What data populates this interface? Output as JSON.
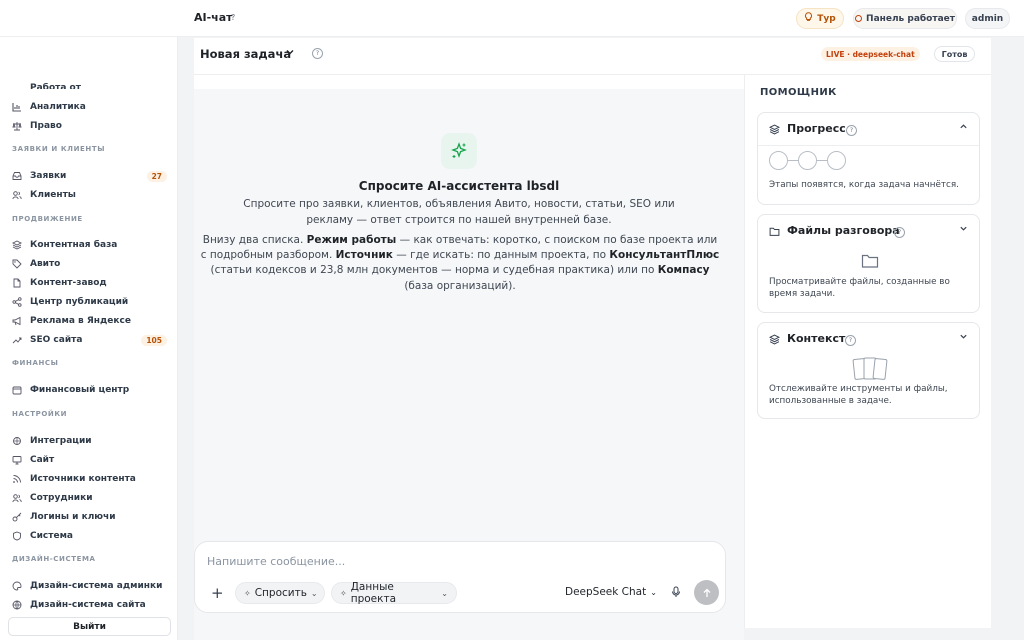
{
  "header": {
    "app_title": "AI-чат",
    "help": "?",
    "tour_label": "Тур",
    "panel_label": "Панель работает",
    "admin_label": "admin"
  },
  "sidebar": {
    "cut_item": "Работа от отзыв",
    "items_top": [
      {
        "icon": "chart-icon",
        "label": "Аналитика"
      },
      {
        "icon": "scale-icon",
        "label": "Право"
      }
    ],
    "sections": {
      "requests": "ЗАЯВКИ И КЛИЕНТЫ",
      "promotion": "ПРОДВИЖЕНИЕ",
      "finance": "ФИНАНСЫ",
      "settings": "НАСТРОЙКИ",
      "design": "ДИЗАЙН-СИСТЕМА"
    },
    "requests_items": [
      {
        "icon": "inbox-icon",
        "label": "Заявки",
        "badge": "27"
      },
      {
        "icon": "users-icon",
        "label": "Клиенты"
      }
    ],
    "promotion_items": [
      {
        "icon": "layers-icon",
        "label": "Контентная база"
      },
      {
        "icon": "tag-icon",
        "label": "Авито"
      },
      {
        "icon": "file-icon",
        "label": "Контент-завод"
      },
      {
        "icon": "share-icon",
        "label": "Центр публикаций"
      },
      {
        "icon": "megaphone-icon",
        "label": "Реклама в Яндексе"
      },
      {
        "icon": "trend-icon",
        "label": "SEO сайта",
        "badge": "105"
      }
    ],
    "finance_items": [
      {
        "icon": "wallet-icon",
        "label": "Финансовый центр"
      }
    ],
    "settings_items": [
      {
        "icon": "plug-icon",
        "label": "Интеграции"
      },
      {
        "icon": "monitor-icon",
        "label": "Сайт"
      },
      {
        "icon": "rss-icon",
        "label": "Источники контента"
      },
      {
        "icon": "team-icon",
        "label": "Сотрудники"
      },
      {
        "icon": "key-icon",
        "label": "Логины и ключи"
      },
      {
        "icon": "shield-icon",
        "label": "Система"
      }
    ],
    "design_items": [
      {
        "icon": "palette-icon",
        "label": "Дизайн-система админки"
      },
      {
        "icon": "globe-icon",
        "label": "Дизайн-система сайта"
      }
    ],
    "logout_label": "Выйти"
  },
  "task": {
    "title": "Новая задача",
    "live_badge": "LIVE · deepseek-chat",
    "status": "Готов"
  },
  "chat": {
    "empty_title": "Спросите AI-ассистента lbsdl",
    "empty_desc": "Спросите про заявки, клиентов, объявления Авито, новости, статьи, SEO или рекламу — ответ строится по нашей внутренней базе.",
    "hint_1": "Внизу два списка. ",
    "hint_mode": "Режим работы",
    "hint_2": " — как отвечать: коротко, с поиском по базе проекта или с подробным разбором. ",
    "hint_source": "Источник",
    "hint_3": " — где искать: по данным проекта, по ",
    "hint_kp": "КонсультантПлюс",
    "hint_4": " (статьи кодексов и 23,8 млн документов — норма и судебная практика) или по ",
    "hint_compass": "Компасу",
    "hint_5": " (база организаций).",
    "input_placeholder": "Напишите сообщение...",
    "ask_label": "Спросить",
    "data_label": "Данные проекта",
    "model_label": "DeepSeek Chat"
  },
  "panel": {
    "title": "ПОМОЩНИК",
    "progress_title": "Прогресс",
    "progress_text": "Этапы появятся, когда задача начнётся.",
    "files_title": "Файлы разговора",
    "files_text": "Просматривайте файлы, созданные во время задачи.",
    "context_title": "Контекст",
    "context_text": "Отслеживайте инструменты и файлы, использованные в задаче."
  },
  "colors": {
    "accent": "#c2410c",
    "success": "#16a34a"
  }
}
